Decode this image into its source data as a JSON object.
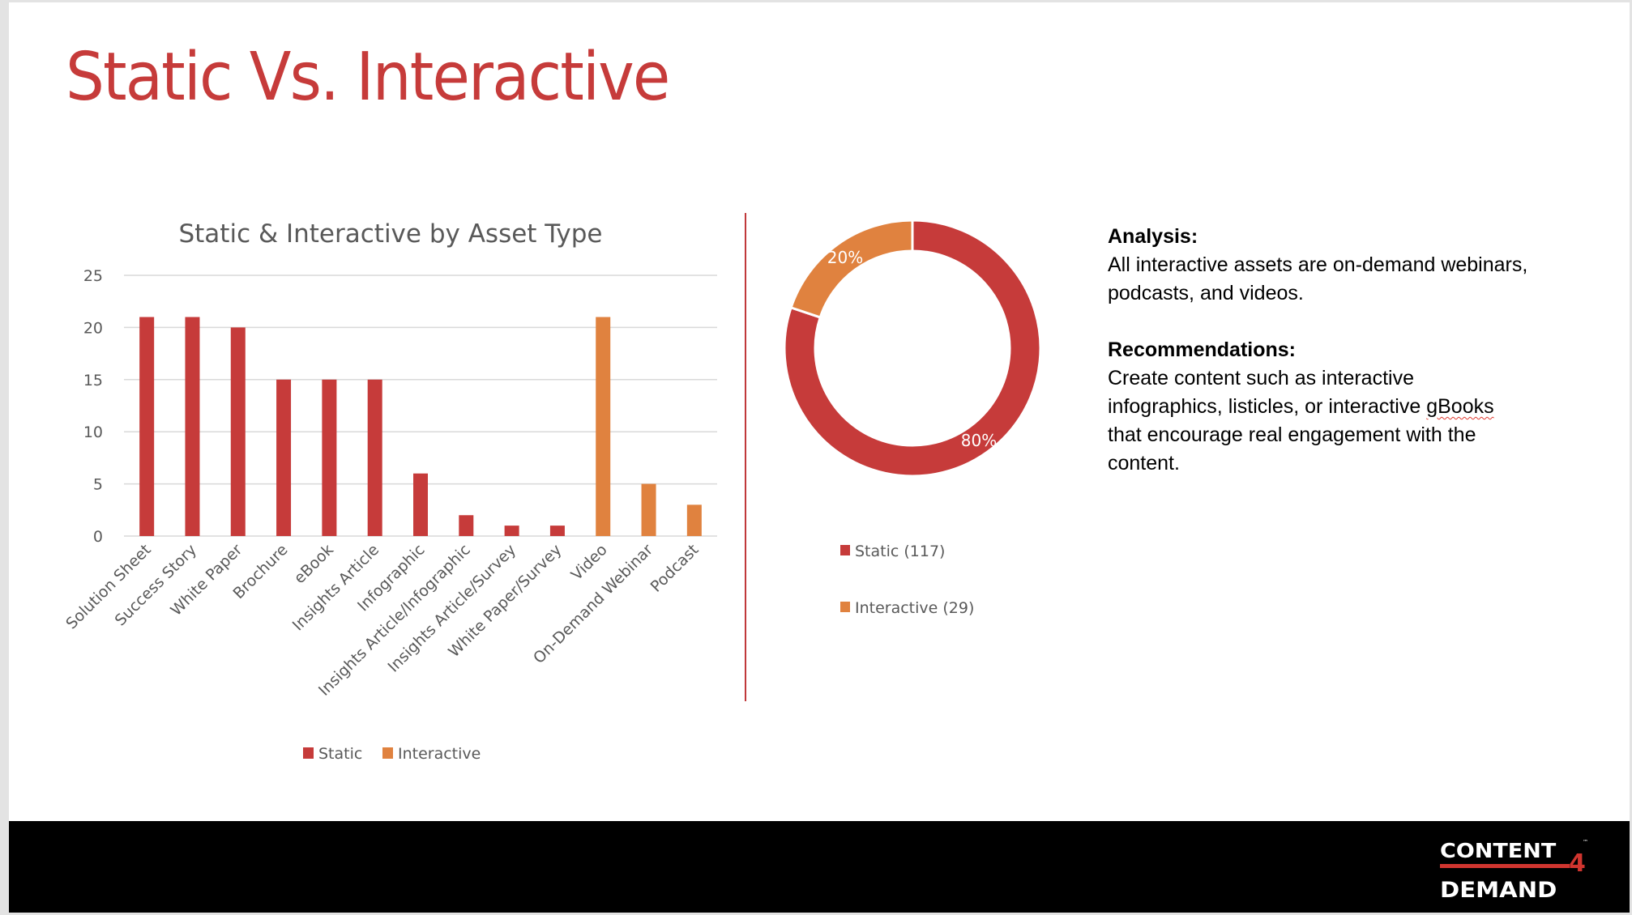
{
  "slide": {
    "title": "Static Vs. Interactive"
  },
  "colors": {
    "static": "#c63b3a",
    "interactive": "#e0823f",
    "title": "#c63b3a",
    "gridline": "#d9d9d9",
    "axis_text": "#595959"
  },
  "chart_data": [
    {
      "type": "bar",
      "title": "Static & Interactive by Asset Type",
      "xlabel": "",
      "ylabel": "",
      "ylim": [
        0,
        25
      ],
      "yticks": [
        0,
        5,
        10,
        15,
        20,
        25
      ],
      "grid": true,
      "legend_position": "bottom",
      "categories": [
        "Solution Sheet",
        "Success Story",
        "White Paper",
        "Brochure",
        "eBook",
        "Insights Article",
        "Infographic",
        "Insights Article/Infographic",
        "Insights Article/Survey",
        "White Paper/Survey",
        "Video",
        "On-Demand Webinar",
        "Podcast"
      ],
      "series": [
        {
          "name": "Static",
          "values": [
            21,
            21,
            20,
            15,
            15,
            15,
            6,
            2,
            1,
            1,
            0,
            0,
            0
          ]
        },
        {
          "name": "Interactive",
          "values": [
            0,
            0,
            0,
            0,
            0,
            0,
            0,
            0,
            0,
            0,
            21,
            5,
            3
          ]
        }
      ],
      "bar_categories_series": [
        "Static",
        "Static",
        "Static",
        "Static",
        "Static",
        "Static",
        "Static",
        "Static",
        "Static",
        "Static",
        "Interactive",
        "Interactive",
        "Interactive"
      ]
    },
    {
      "type": "pie",
      "variant": "donut",
      "title": "",
      "legend_position": "bottom",
      "slices": [
        {
          "name": "Static",
          "value": 117,
          "label": "80%",
          "legend": "Static (117)"
        },
        {
          "name": "Interactive",
          "value": 29,
          "label": "20%",
          "legend": "Interactive (29)"
        }
      ]
    }
  ],
  "notes": {
    "analysis_heading": "Analysis:",
    "analysis_text": "All interactive assets are on-demand webinars, podcasts, and videos.",
    "recommendations_heading": "Recommendations:",
    "recommendations_lines": [
      "Create content such as interactive",
      "infographics, listicles, or interactive ",
      "that encourage real engagement with the",
      "content."
    ],
    "misspelled_word": "gBooks"
  },
  "footer": {
    "logo_top": "CONTENT",
    "logo_number": "4",
    "logo_bottom": "DEMAND",
    "logo_tm": "™"
  }
}
